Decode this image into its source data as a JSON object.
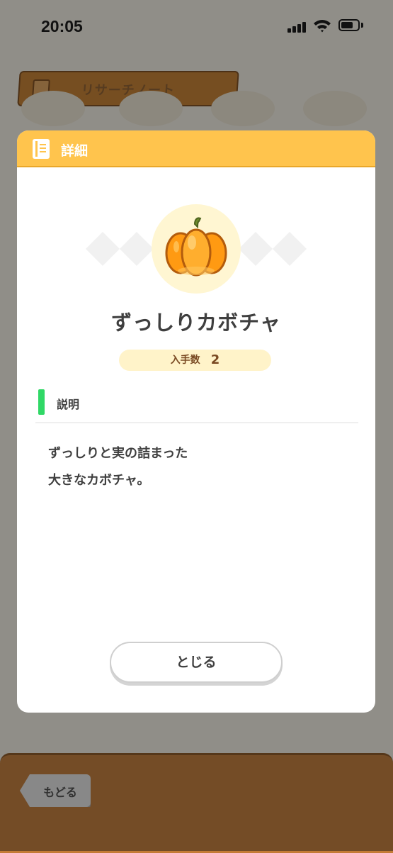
{
  "status_bar": {
    "time": "20:05"
  },
  "background": {
    "title": "リサーチノート",
    "back_button_label": "もどる"
  },
  "modal": {
    "header_title": "詳細",
    "item_name": "ずっしりカボチャ",
    "count_label": "入手数",
    "count_value": "2",
    "section_title": "説明",
    "description_lines": [
      "ずっしりと実の詰まった",
      "大きなカボチャ。"
    ],
    "close_label": "とじる"
  },
  "colors": {
    "header": "#ffc44d",
    "accent_green": "#30d866",
    "count_pill": "#fff3c9",
    "pumpkin": "#ffa21e",
    "bottom_bar": "#c47b36"
  },
  "icons": [
    "notebook-icon",
    "pumpkin-icon",
    "signal-icon",
    "wifi-icon",
    "battery-icon"
  ]
}
